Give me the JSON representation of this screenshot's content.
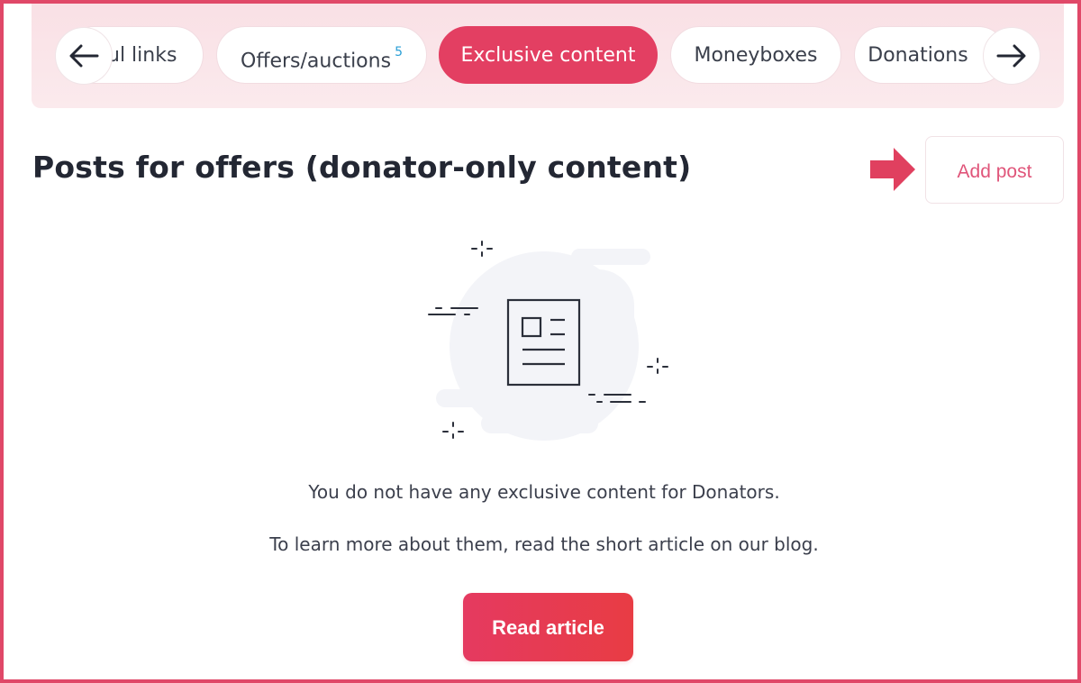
{
  "tabs": {
    "items": [
      {
        "label": "ul links",
        "badge": null,
        "active": false
      },
      {
        "label": "Offers/auctions",
        "badge": "5",
        "active": false
      },
      {
        "label": "Exclusive content",
        "badge": null,
        "active": true
      },
      {
        "label": "Moneyboxes",
        "badge": null,
        "active": false
      },
      {
        "label": "Donations",
        "badge": null,
        "active": false
      }
    ],
    "prev_icon": "arrow-left-icon",
    "next_icon": "arrow-right-icon"
  },
  "header": {
    "title": "Posts for offers (donator-only content)",
    "add_post_label": "Add post",
    "pointer_icon": "pointer-arrow-icon"
  },
  "empty_state": {
    "illustration_icon": "document-icon",
    "message": "You do not have any exclusive content for Donators.",
    "hint": "To learn more about them, read the short article on our blog.",
    "button_label": "Read article"
  },
  "colors": {
    "accent": "#e33f62",
    "frame_border": "#e04868",
    "badge": "#2a9fd6",
    "tabs_background": "#f9e0e5",
    "text_primary": "#232733"
  }
}
